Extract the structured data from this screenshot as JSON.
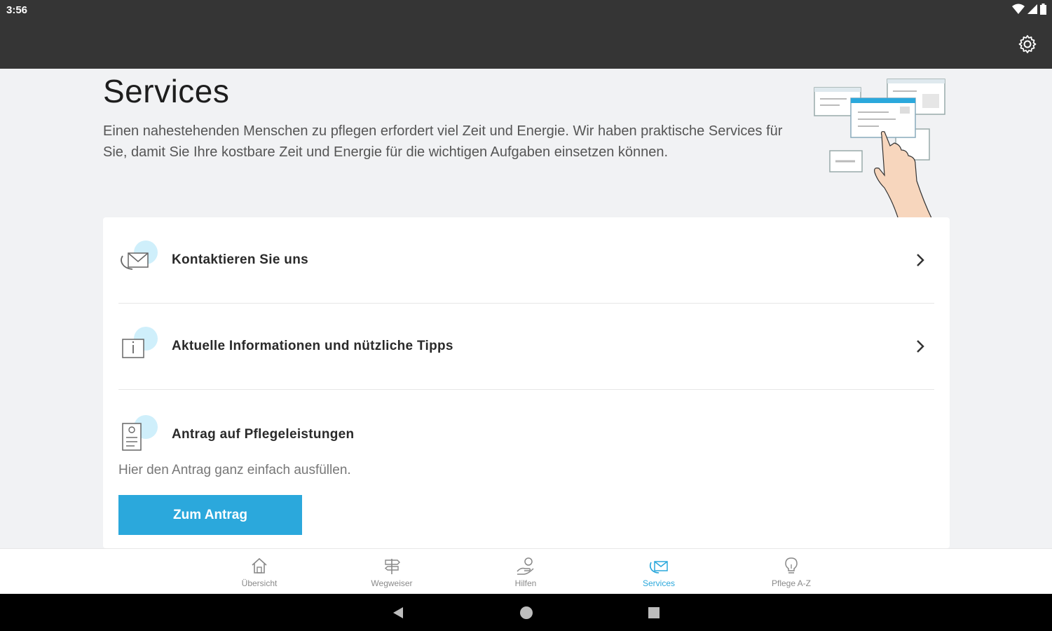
{
  "status_bar": {
    "time": "3:56"
  },
  "header": {
    "title": "Services",
    "intro": "Einen nahestehenden Menschen zu pflegen erfordert viel Zeit und Energie. Wir haben praktische Services für Sie, damit Sie Ihre kostbare Zeit und Energie für die wichtigen Aufgaben einsetzen können."
  },
  "list": {
    "items": [
      {
        "label": "Kontaktieren Sie uns",
        "icon": "contact-icon"
      },
      {
        "label": "Aktuelle Informationen und nützliche Tipps",
        "icon": "info-icon"
      }
    ],
    "antrag": {
      "label": "Antrag auf Pflegeleistungen",
      "icon": "form-icon",
      "description": "Hier den Antrag ganz einfach ausfüllen.",
      "button": "Zum Antrag"
    }
  },
  "bottom_nav": {
    "items": [
      {
        "label": "Übersicht",
        "icon": "home-icon"
      },
      {
        "label": "Wegweiser",
        "icon": "signpost-icon"
      },
      {
        "label": "Hilfen",
        "icon": "help-hand-icon"
      },
      {
        "label": "Services",
        "icon": "services-icon",
        "active": true
      },
      {
        "label": "Pflege A-Z",
        "icon": "lightbulb-icon"
      }
    ]
  },
  "colors": {
    "accent": "#2ba8dc",
    "appbar": "#353535",
    "bubble": "#cfeffb"
  }
}
